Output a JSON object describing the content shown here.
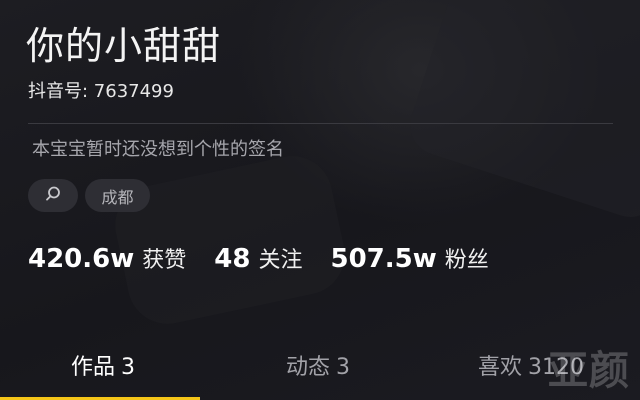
{
  "profile": {
    "username": "你的小甜甜",
    "douyin_id": "抖音号: 7637499",
    "signature": "本宝宝暂时还没想到个性的签名",
    "tags": {
      "search_icon": "search-icon",
      "city": "成都"
    }
  },
  "stats": {
    "likes": {
      "value": "420.6w",
      "label": "获赞"
    },
    "following": {
      "value": "48",
      "label": "关注"
    },
    "followers": {
      "value": "507.5w",
      "label": "粉丝"
    }
  },
  "tabs": {
    "works": {
      "label": "作品",
      "count": "3"
    },
    "dynamic": {
      "label": "动态",
      "count": "3"
    },
    "likes": {
      "label": "喜欢",
      "count": "3120"
    }
  },
  "watermark": "亚颜",
  "colors": {
    "background": "#1a1a20",
    "accent_underline": "#f5c518",
    "tag_background": "#2e2e34",
    "muted_text": "#a6a6ac"
  }
}
